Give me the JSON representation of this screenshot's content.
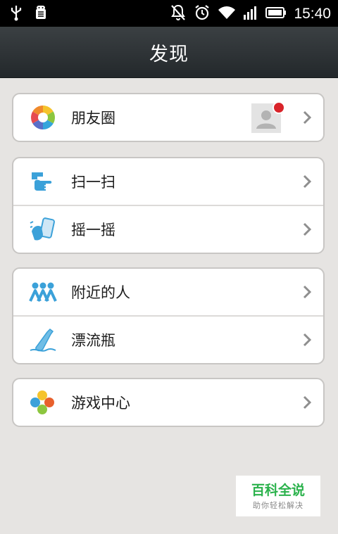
{
  "status_bar": {
    "time": "15:40",
    "icons": [
      "usb-icon",
      "android-debug-icon",
      "muted-bell-icon",
      "alarm-icon",
      "wifi-icon",
      "signal-icon",
      "battery-icon"
    ]
  },
  "header": {
    "title": "发现"
  },
  "groups": [
    {
      "items": [
        {
          "label": "朋友圈",
          "icon": "moments-camera-icon",
          "badge": "red-dot"
        }
      ]
    },
    {
      "items": [
        {
          "label": "扫一扫",
          "icon": "scan-hand-icon"
        },
        {
          "label": "摇一摇",
          "icon": "shake-phone-icon"
        }
      ]
    },
    {
      "items": [
        {
          "label": "附近的人",
          "icon": "nearby-people-icon"
        },
        {
          "label": "漂流瓶",
          "icon": "drift-bottle-icon"
        }
      ]
    },
    {
      "items": [
        {
          "label": "游戏中心",
          "icon": "game-center-icon"
        }
      ]
    }
  ],
  "watermark": {
    "title": "百科全说",
    "subtitle": "助你轻松解决"
  },
  "colors": {
    "title_bar": "#2d3235",
    "background": "#e6e4e2",
    "badge": "#e02020",
    "watermark_green": "#2bb24c"
  }
}
